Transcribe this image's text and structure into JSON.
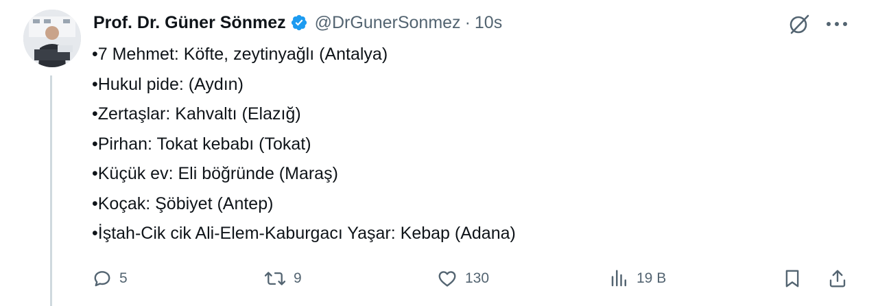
{
  "tweet": {
    "author_name": "Prof. Dr. Güner Sönmez",
    "handle": "@DrGunerSonmez",
    "separator": "·",
    "time": "10s",
    "lines": [
      "•7 Mehmet: Köfte, zeytinyağlı (Antalya)",
      "•Hukul pide: (Aydın)",
      "•Zertaşlar: Kahvaltı (Elazığ)",
      "•Pirhan: Tokat kebabı (Tokat)",
      "•Küçük ev: Eli böğründe (Maraş)",
      "•Koçak: Şöbiyet (Antep)",
      "•İştah-Cik cik Ali-Elem-Kaburgacı Yaşar: Kebap (Adana)"
    ]
  },
  "actions": {
    "replies": "5",
    "retweets": "9",
    "likes": "130",
    "views": "19 B"
  },
  "icons": {
    "verified": "verified-badge-icon",
    "grok": "grok-icon",
    "more": "more-icon",
    "reply": "reply-icon",
    "retweet": "retweet-icon",
    "like": "like-icon",
    "views": "views-icon",
    "bookmark": "bookmark-icon",
    "share": "share-icon"
  },
  "colors": {
    "verified_blue": "#1d9bf0",
    "text_primary": "#0f1419",
    "text_secondary": "#536471",
    "thread_line": "#cfd9de"
  }
}
